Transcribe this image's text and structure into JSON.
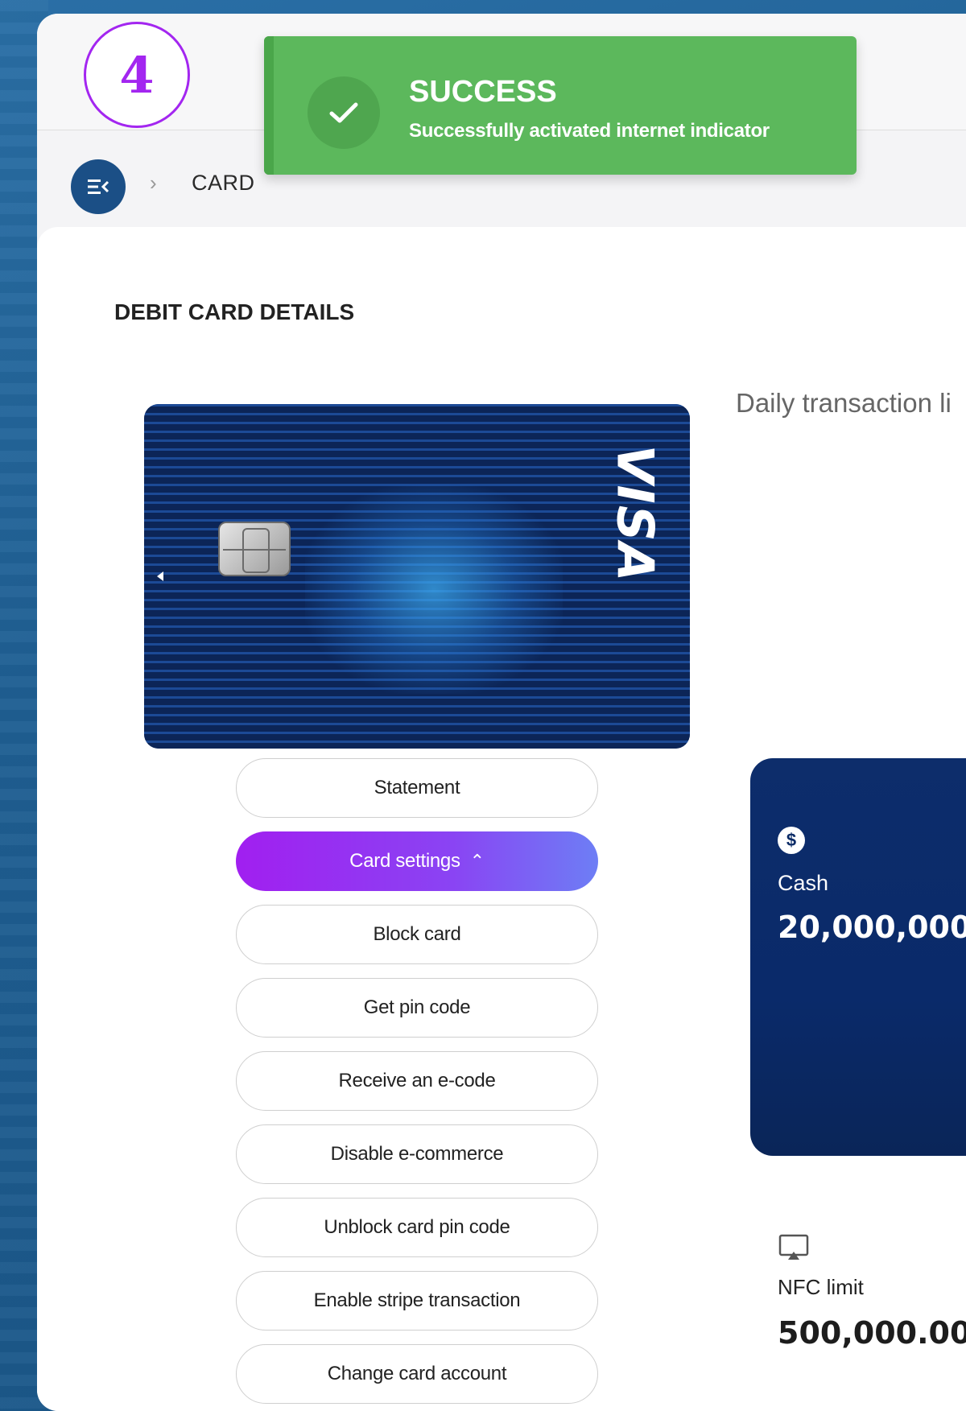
{
  "step_badge": "4",
  "toast": {
    "title": "SUCCESS",
    "message": "Successfully activated internet indicator",
    "icon": "check-icon",
    "color": "#5cb85c"
  },
  "breadcrumb": {
    "menu_icon": "menu-collapse-icon",
    "separator": "›",
    "current": "CARD"
  },
  "section_title": "DEBIT CARD DETAILS",
  "card": {
    "brand": "VISA"
  },
  "actions": [
    {
      "label": "Statement"
    },
    {
      "label": "Card settings",
      "expanded": true
    },
    {
      "label": "Block card"
    },
    {
      "label": "Get pin code"
    },
    {
      "label": "Receive an e-code"
    },
    {
      "label": "Disable e-commerce"
    },
    {
      "label": "Unblock card pin code"
    },
    {
      "label": "Enable stripe transaction"
    },
    {
      "label": "Change card account"
    }
  ],
  "limits": {
    "header": "Daily transaction li",
    "cash": {
      "icon": "dollar-icon",
      "label": "Cash",
      "value": "20,000,000."
    },
    "nfc": {
      "icon": "airplay-icon",
      "label": "NFC limit",
      "value": "500,000.00"
    }
  },
  "colors": {
    "accent_gradient_start": "#a11ff0",
    "accent_gradient_end": "#6d7ef5",
    "step_badge": "#a326f0",
    "menu_button": "#1b4f86",
    "cash_card": "#0b2b66"
  }
}
